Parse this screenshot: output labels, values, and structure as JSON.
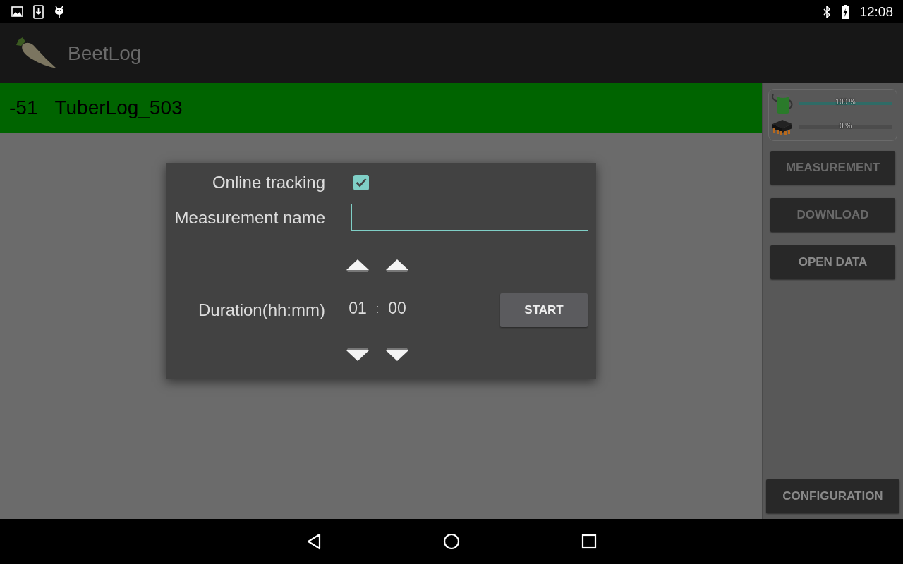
{
  "status_bar": {
    "time": "12:08"
  },
  "app_bar": {
    "title": "BeetLog"
  },
  "device_bar": {
    "signal": "-51",
    "name": "TuberLog_503"
  },
  "dialog": {
    "online_tracking": {
      "label": "Online tracking",
      "checked": true
    },
    "measurement_name": {
      "label": "Measurement name"
    },
    "duration": {
      "label": "Duration(hh:mm)",
      "hours": "01",
      "separator": ":",
      "minutes": "00"
    },
    "start_button": "START"
  },
  "side_panel": {
    "meters": [
      {
        "kind": "battery",
        "level": 1,
        "reading": "100 %"
      },
      {
        "kind": "memory",
        "level": 0,
        "reading": "0 %"
      }
    ],
    "buttons": [
      {
        "label": "MEASUREMENT",
        "disabled": true
      },
      {
        "label": "DOWNLOAD",
        "disabled": true
      },
      {
        "label": "OPEN DATA",
        "disabled": false
      }
    ],
    "configuration_button": "CONFIGURATION"
  }
}
